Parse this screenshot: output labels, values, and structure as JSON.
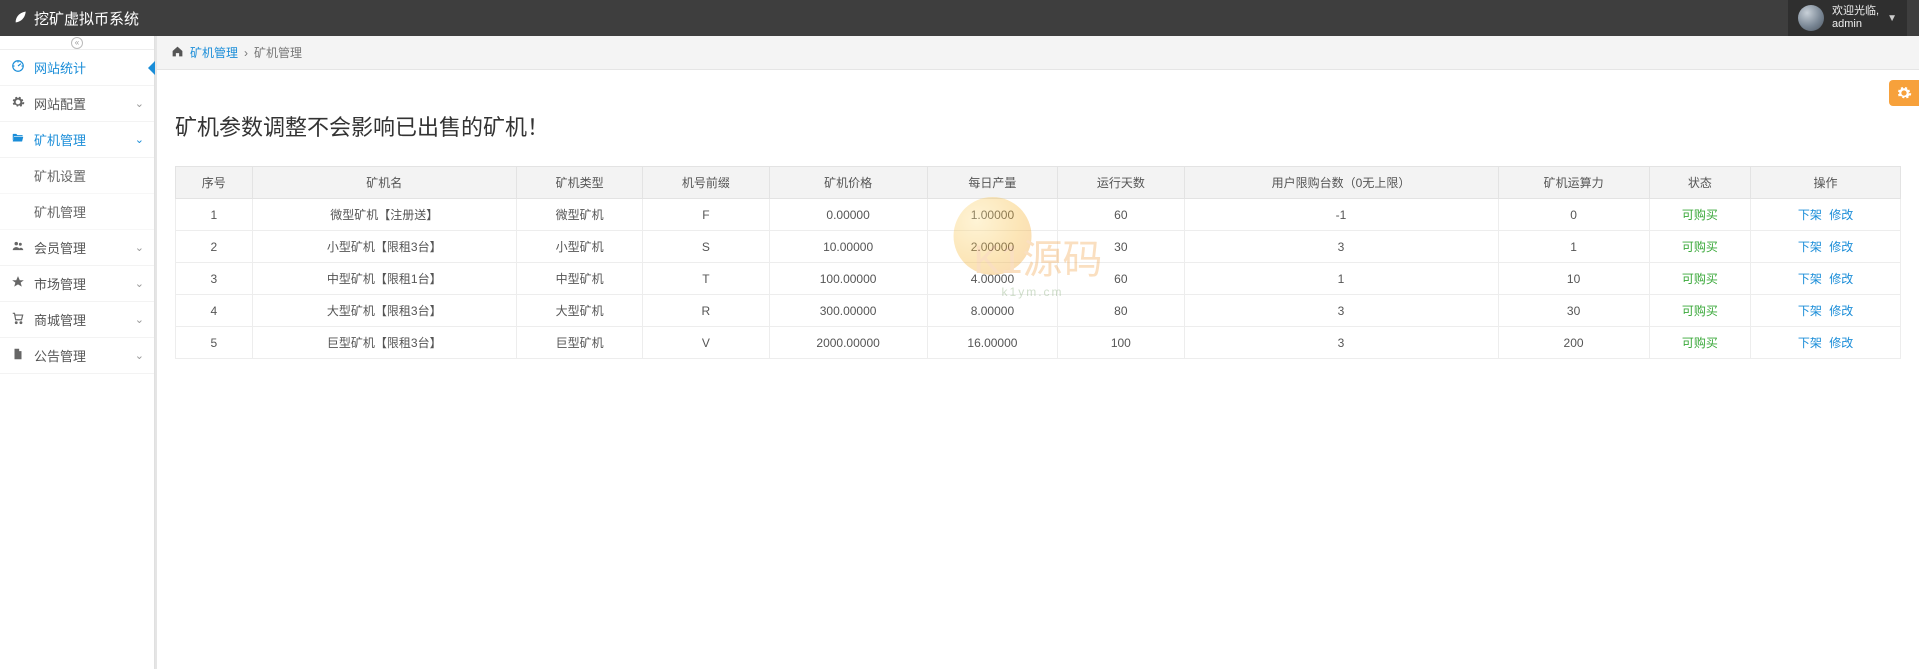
{
  "app": {
    "title": "挖矿虚拟币系统"
  },
  "user": {
    "welcome": "欢迎光临,",
    "name": "admin"
  },
  "sidebar": {
    "items": [
      {
        "icon": "dashboard",
        "label": "网站统计"
      },
      {
        "icon": "gear",
        "label": "网站配置",
        "chev": true
      },
      {
        "icon": "folder",
        "label": "矿机管理",
        "chev": true,
        "open": true
      },
      {
        "icon": "users",
        "label": "会员管理",
        "chev": true
      },
      {
        "icon": "star",
        "label": "市场管理",
        "chev": true
      },
      {
        "icon": "cart",
        "label": "商城管理",
        "chev": true
      },
      {
        "icon": "doc",
        "label": "公告管理",
        "chev": true
      }
    ],
    "sub": [
      {
        "label": "矿机设置"
      },
      {
        "label": "矿机管理"
      }
    ]
  },
  "breadcrumb": {
    "a": "矿机管理",
    "sep": "›",
    "b": "矿机管理"
  },
  "page": {
    "title": "矿机参数调整不会影响已出售的矿机！"
  },
  "table": {
    "headers": [
      "序号",
      "矿机名",
      "矿机类型",
      "机号前缀",
      "矿机价格",
      "每日产量",
      "运行天数",
      "用户限购台数（0无上限）",
      "矿机运算力",
      "状态",
      "操作"
    ],
    "status_ok": "可购买",
    "op_off": "下架",
    "op_edit": "修改",
    "rows": [
      {
        "seq": "1",
        "name": "微型矿机【注册送】",
        "type": "微型矿机",
        "prefix": "F",
        "price": "0.00000",
        "daily": "1.00000",
        "days": "60",
        "limit": "-1",
        "power": "0"
      },
      {
        "seq": "2",
        "name": "小型矿机【限租3台】",
        "type": "小型矿机",
        "prefix": "S",
        "price": "10.00000",
        "daily": "2.00000",
        "days": "30",
        "limit": "3",
        "power": "1"
      },
      {
        "seq": "3",
        "name": "中型矿机【限租1台】",
        "type": "中型矿机",
        "prefix": "T",
        "price": "100.00000",
        "daily": "4.00000",
        "days": "60",
        "limit": "1",
        "power": "10"
      },
      {
        "seq": "4",
        "name": "大型矿机【限租3台】",
        "type": "大型矿机",
        "prefix": "R",
        "price": "300.00000",
        "daily": "8.00000",
        "days": "80",
        "limit": "3",
        "power": "30"
      },
      {
        "seq": "5",
        "name": "巨型矿机【限租3台】",
        "type": "巨型矿机",
        "prefix": "V",
        "price": "2000.00000",
        "daily": "16.00000",
        "days": "100",
        "limit": "3",
        "power": "200"
      }
    ]
  },
  "watermark": {
    "text": "K1源码",
    "sub": "k1ym.cm"
  }
}
